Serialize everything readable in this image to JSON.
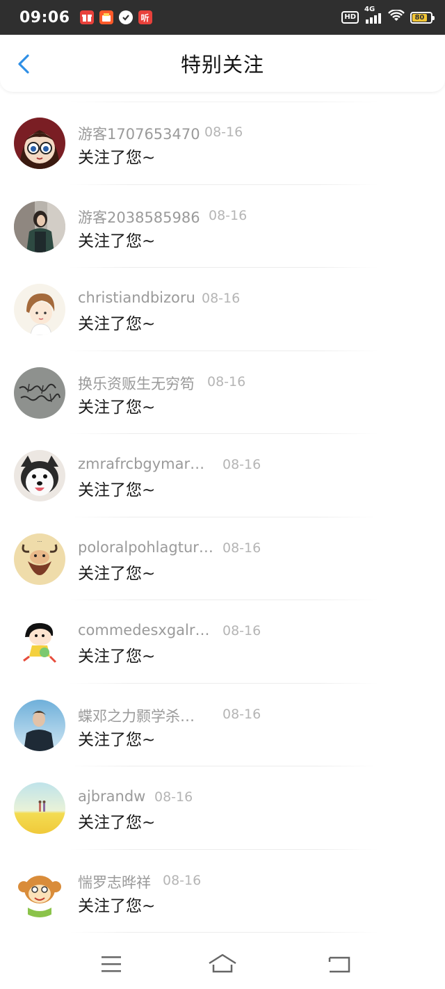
{
  "status_bar": {
    "time": "09:06",
    "notification_icons": [
      "gift-icon",
      "shop-icon",
      "check-circle-icon",
      "ting-app-icon"
    ],
    "ting_label": "听",
    "hd_label": "HD",
    "network_label": "4G",
    "battery_level": "80"
  },
  "header": {
    "title": "特别关注",
    "back_icon": "chevron-left-icon",
    "accent_color": "#2f8fe6"
  },
  "notifications": [
    {
      "name": "游客1707653470",
      "date": "08-16",
      "message": "关注了您~",
      "avatar": "anime-girl-glasses"
    },
    {
      "name": "游客2038585986",
      "date": "08-16",
      "message": "关注了您~",
      "avatar": "photo-girl-street"
    },
    {
      "name": "christiandbizoru",
      "date": "08-16",
      "message": "关注了您~",
      "avatar": "cartoon-boy-brown-hair"
    },
    {
      "name": "换乐资贩生无穷笱",
      "date": "08-16",
      "message": "关注了您~",
      "avatar": "handwriting-note"
    },
    {
      "name": "zmrafrcbgymar…",
      "date": "08-16",
      "message": "关注了您~",
      "avatar": "husky-dog"
    },
    {
      "name": "poloralpohlagtur…",
      "date": "08-16",
      "message": "关注了您~",
      "avatar": "bearded-cartoon"
    },
    {
      "name": "commedesxgalr…",
      "date": "08-16",
      "message": "关注了您~",
      "avatar": "crayon-shin-chan"
    },
    {
      "name": "蝶邓之力颢学杀…",
      "date": "08-16",
      "message": "关注了您~",
      "avatar": "photo-man-sky"
    },
    {
      "name": "ajbrandw",
      "date": "08-16",
      "message": "关注了您~",
      "avatar": "yellow-field-landscape"
    },
    {
      "name": "惴罗志晔祥",
      "date": "08-16",
      "message": "关注了您~",
      "avatar": "cartoon-monkey-face"
    }
  ],
  "nav_bar": {
    "buttons": [
      "menu-icon",
      "home-icon",
      "back-icon"
    ]
  }
}
